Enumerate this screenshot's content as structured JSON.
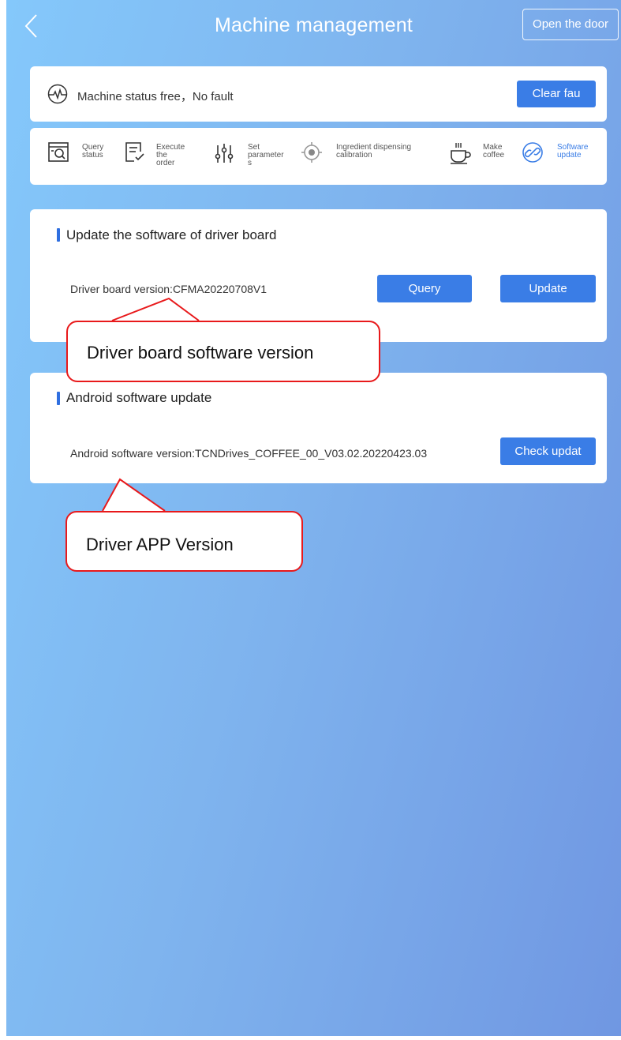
{
  "header": {
    "title": "Machine management",
    "open_door_label": "Open the door"
  },
  "status": {
    "text": "Machine status  free，No fault",
    "clear_fault_label": "Clear fau"
  },
  "tools": [
    {
      "label": "Query\nstatus",
      "icon": "query-status-icon",
      "active": false
    },
    {
      "label": "Execute the\norder",
      "icon": "execute-order-icon",
      "active": false
    },
    {
      "label": "Set\nparameter\ns",
      "icon": "set-parameters-icon",
      "active": false
    },
    {
      "label": "Ingredient dispensing\ncalibration",
      "icon": "calibration-icon",
      "active": false
    },
    {
      "label": "Make\ncoffee",
      "icon": "coffee-cup-icon",
      "active": false
    },
    {
      "label": "Software\nupdate",
      "icon": "software-update-icon",
      "active": true
    }
  ],
  "driver_section": {
    "title": "Update the software of driver board",
    "version_text": "Driver board version:CFMA20220708V1",
    "query_label": "Query",
    "update_label": "Update"
  },
  "android_section": {
    "title": "Android software update",
    "version_text": "Android software version:TCNDrives_COFFEE_00_V03.02.20220423.03",
    "check_update_label": "Check updat"
  },
  "annotations": {
    "driver_board": "Driver board software version",
    "driver_app": "Driver APP Version"
  },
  "colors": {
    "accent": "#3a7de6",
    "callout_border": "#e8191b",
    "background_start": "#84c8fb",
    "background_end": "#7097e2"
  }
}
